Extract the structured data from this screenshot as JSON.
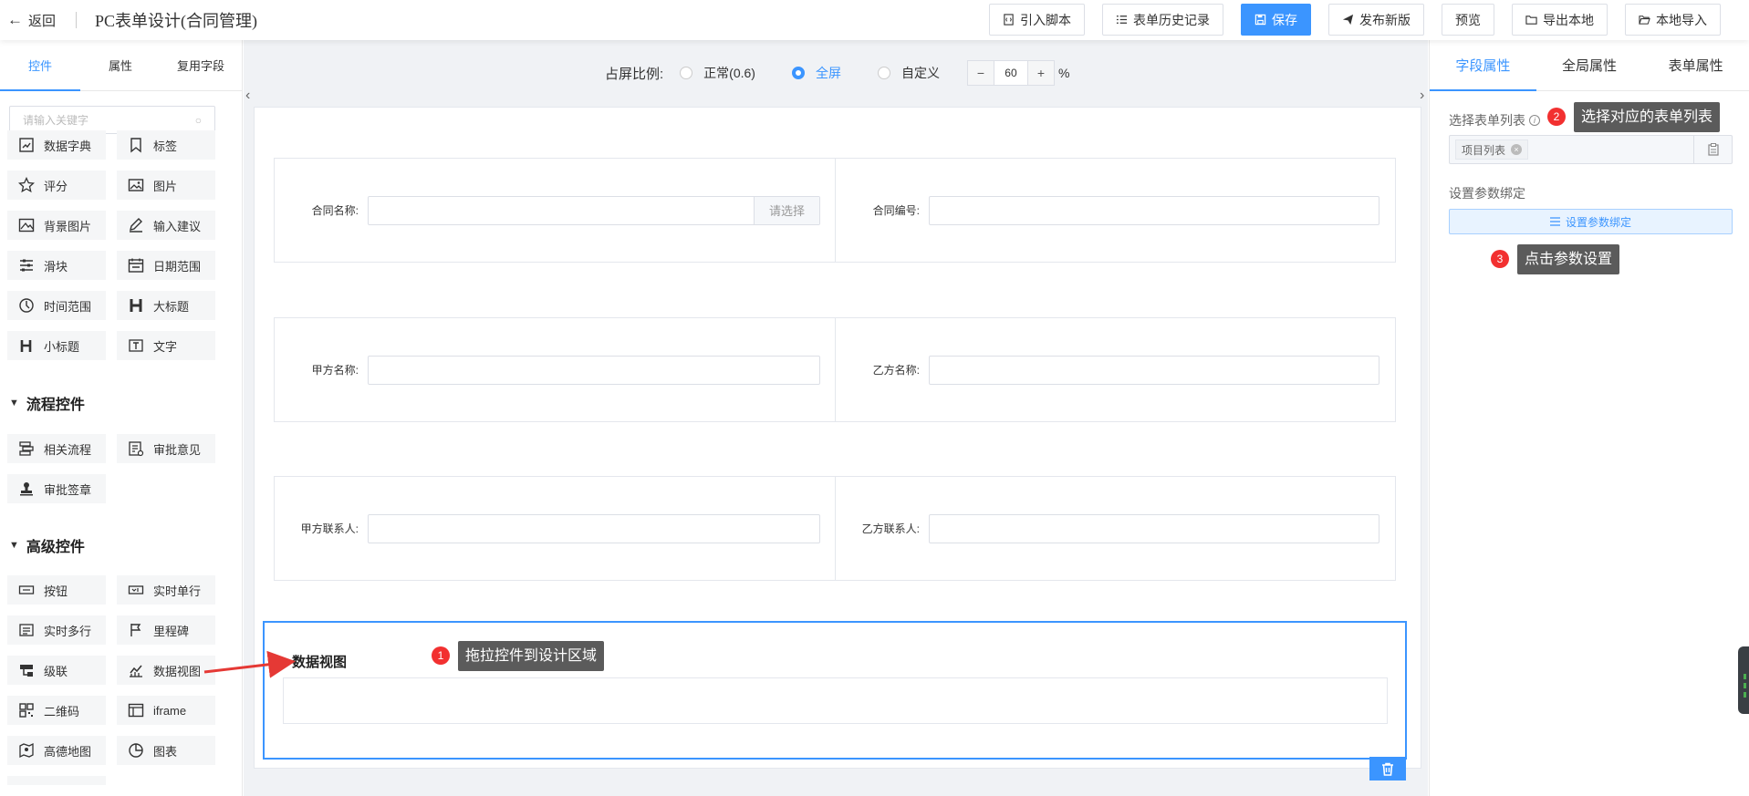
{
  "header": {
    "back_label": "返回",
    "title": "PC表单设计(合同管理)",
    "buttons": {
      "import_script": "引入脚本",
      "history": "表单历史记录",
      "save": "保存",
      "publish": "发布新版",
      "preview": "预览",
      "export_local": "导出本地",
      "import_local": "本地导入"
    }
  },
  "left_panel": {
    "tabs": [
      "控件",
      "属性",
      "复用字段"
    ],
    "search_placeholder": "请输入关键字",
    "items": {
      "data_dict": "数据字典",
      "tag": "标签",
      "rating": "评分",
      "image": "图片",
      "bg_image": "背景图片",
      "input_suggest": "输入建议",
      "slider": "滑块",
      "date_range": "日期范围",
      "time_range": "时间范围",
      "big_title": "大标题",
      "small_title": "小标题",
      "text": "文字"
    },
    "flow_section": "流程控件",
    "flow_items": {
      "related_flow": "相关流程",
      "approval_opinion": "审批意见",
      "approval_seal": "审批签章"
    },
    "advanced_section": "高级控件",
    "advanced_items": {
      "button": "按钮",
      "realtime_single": "实时单行",
      "realtime_multi": "实时多行",
      "milestone": "里程碑",
      "cascade": "级联",
      "data_view": "数据视图",
      "qrcode": "二维码",
      "iframe": "iframe",
      "amap": "高德地图",
      "chart": "图表"
    }
  },
  "middle": {
    "ratio_label": "占屏比例:",
    "options": [
      "正常(0.6)",
      "全屏",
      "自定义"
    ],
    "selected_option": "全屏",
    "zoom_value": "60",
    "zoom_unit": "%",
    "stepper_minus": "−",
    "stepper_plus": "+",
    "fields": {
      "contract_name": "合同名称:",
      "select_button": "请选择",
      "contract_no": "合同编号:",
      "party_a": "甲方名称:",
      "party_b": "乙方名称:",
      "party_a_contact": "甲方联系人:",
      "party_b_contact": "乙方联系人:"
    },
    "data_view_title": "数据视图"
  },
  "right_panel": {
    "tabs": [
      "字段属性",
      "全局属性",
      "表单属性"
    ],
    "select_list_label": "选择表单列表",
    "selected_tag": "项目列表",
    "param_binding_label": "设置参数绑定",
    "param_binding_button": "设置参数绑定"
  },
  "annotations": {
    "n1": "1",
    "tip1": "拖拉控件到设计区域",
    "n2": "2",
    "tip2": "选择对应的表单列表",
    "n3": "3",
    "tip3": "点击参数设置"
  },
  "colors": {
    "accent": "#3b95ff",
    "badge": "#f23030",
    "tooltip": "#5b5b5b"
  }
}
